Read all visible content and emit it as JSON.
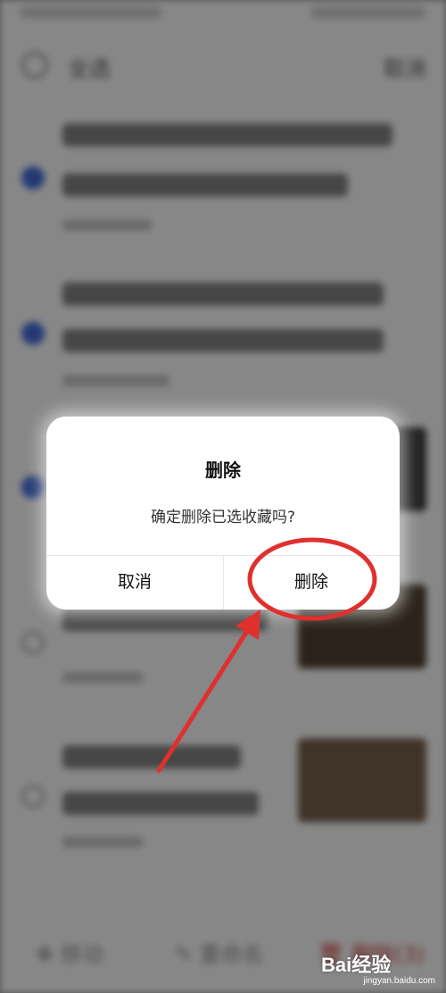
{
  "topbar": {
    "select_all": "全选",
    "cancel": "取消"
  },
  "bottombar": {
    "move": "移动",
    "rename": "重命名",
    "delete": "删除(3)"
  },
  "dialog": {
    "title": "删除",
    "message": "确定删除已选收藏吗?",
    "cancel": "取消",
    "confirm": "删除"
  },
  "watermark": {
    "brand": "Bai经验",
    "url": "jingyan.baidu.com"
  },
  "colors": {
    "annotation": "#e0302e",
    "checked": "#3f63c9",
    "delete": "#c24040"
  }
}
